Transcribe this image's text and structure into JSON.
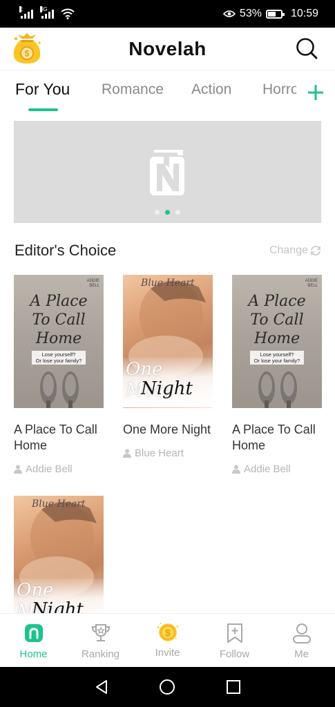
{
  "status_bar": {
    "signal1_label": "E",
    "signal2_label": "3G",
    "battery_percent": "53%",
    "time": "10:59"
  },
  "header": {
    "app_title": "Novelah"
  },
  "tabs": {
    "items": [
      {
        "label": "For You"
      },
      {
        "label": "Romance"
      },
      {
        "label": "Action"
      },
      {
        "label": "Horror"
      }
    ],
    "active_index": 0
  },
  "banner": {
    "dot_count": 3,
    "active_dot": 1
  },
  "editors_choice": {
    "title": "Editor's Choice",
    "change_label": "Change",
    "books": [
      {
        "title": "A Place To Call Home",
        "author": "Addie Bell",
        "cover_style": "sand",
        "cover_author_line1": "ADDIE",
        "cover_author_line2": "BELL",
        "cover_title_line1": "A Place",
        "cover_title_line2": "To Call",
        "cover_title_line3": "Home",
        "cover_tagline_1": "Lose yourself?",
        "cover_tagline_2": "Or lose your family?"
      },
      {
        "title": "One More Night",
        "author": "Blue Heart",
        "cover_style": "warm",
        "cover_brand": "Blue Heart",
        "cover_title_line1": "One More",
        "cover_title_line2": "Night"
      },
      {
        "title": "A Place To Call Home",
        "author": "Addie Bell",
        "cover_style": "sand",
        "cover_author_line1": "ADDIE",
        "cover_author_line2": "BELL",
        "cover_title_line1": "A Place",
        "cover_title_line2": "To Call",
        "cover_title_line3": "Home",
        "cover_tagline_1": "Lose yourself?",
        "cover_tagline_2": "Or lose your family?"
      },
      {
        "title": "",
        "author": "",
        "cover_style": "warm",
        "cover_brand": "Blue Heart",
        "cover_title_line1": "One More",
        "cover_title_line2": "Night"
      }
    ]
  },
  "bottom_nav": {
    "items": [
      {
        "label": "Home",
        "icon": "home-icon"
      },
      {
        "label": "Ranking",
        "icon": "trophy-icon"
      },
      {
        "label": "Invite",
        "icon": "coin-icon"
      },
      {
        "label": "Follow",
        "icon": "bookmark-add-icon"
      },
      {
        "label": "Me",
        "icon": "person-icon"
      }
    ],
    "active_index": 0
  },
  "colors": {
    "accent": "#1ec38b",
    "inactive_text": "#a8a8a8",
    "banner_bg": "#dcdcdc"
  }
}
